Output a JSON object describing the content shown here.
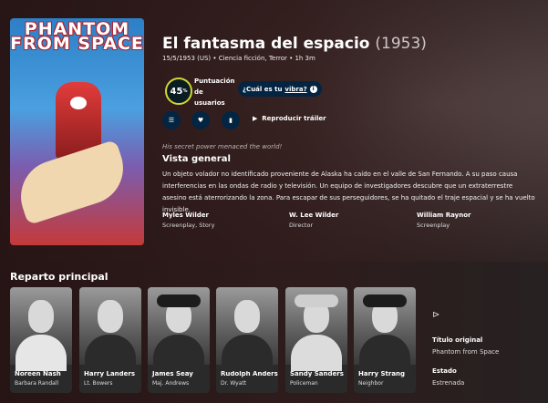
{
  "movie": {
    "poster_text": "PHANTOM FROM SPACE",
    "title": "El fantasma del espacio",
    "year": "(1953)",
    "facts": "15/5/1953 (US)  •  Ciencia ficción, Terror  •  1h 3m",
    "score": "45",
    "score_label_1": "Puntuación",
    "score_label_2": "de",
    "score_label_3": "usuarios",
    "vibe_prefix": "¿Cuál es tu",
    "vibe_link": "vibra?",
    "trailer_label": "Reproducir tráiler",
    "tagline": "His secret power menaced the world!",
    "overview_heading": "Vista general",
    "overview": "Un objeto volador no identificado proveniente de Alaska ha caído en el valle de San Fernando. A su paso causa interferencias en las ondas de radio y televisión. Un equipo de investigadores descubre que un extraterrestre asesino está aterrorizando la zona. Para escapar de sus perseguidores, se ha quitado el traje espacial y se ha vuelto invisible.",
    "crew": [
      {
        "name": "Myles Wilder",
        "role": "Screenplay, Story"
      },
      {
        "name": "W. Lee Wilder",
        "role": "Director"
      },
      {
        "name": "William Raynor",
        "role": "Screenplay"
      }
    ]
  },
  "actions": {
    "list_icon": "list-icon",
    "favorite_icon": "heart-icon",
    "watchlist_icon": "bookmark-icon",
    "play_icon": "play-icon"
  },
  "cast_section": {
    "heading": "Reparto principal",
    "cast": [
      {
        "name": "Noreen Nash",
        "character": "Barbara Randall"
      },
      {
        "name": "Harry Landers",
        "character": "Lt. Bowers"
      },
      {
        "name": "James Seay",
        "character": "Maj. Andrews"
      },
      {
        "name": "Rudolph Anders",
        "character": "Dr. Wyatt"
      },
      {
        "name": "Sandy Sanders",
        "character": "Policeman"
      },
      {
        "name": "Harry Strang",
        "character": "Neighbor"
      }
    ]
  },
  "sidebar": {
    "original_title_label": "Título original",
    "original_title": "Phantom from Space",
    "status_label": "Estado",
    "status": "Estrenada"
  },
  "colors": {
    "accent": "#032541",
    "score_ring": "#d2d531"
  }
}
